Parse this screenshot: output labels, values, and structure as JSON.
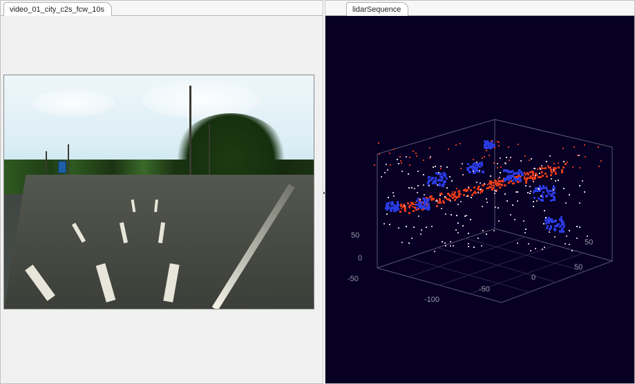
{
  "leftPanel": {
    "tabLabel": "video_01_city_c2s_fcw_10s"
  },
  "rightPanel": {
    "tabLabel": "lidarSequence",
    "axisTicks": {
      "yLeft": [
        "50",
        "0",
        "-50"
      ],
      "xFront": [
        "-100",
        "-50",
        "0",
        "50"
      ],
      "xRight": [
        "50"
      ]
    }
  }
}
